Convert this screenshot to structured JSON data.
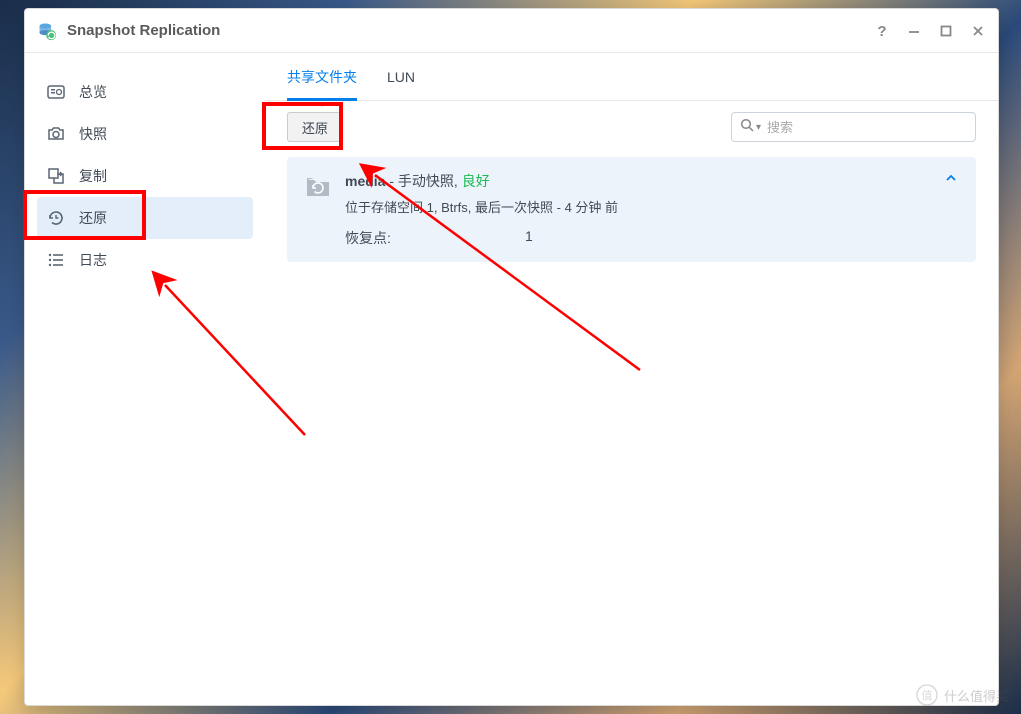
{
  "app": {
    "title": "Snapshot Replication"
  },
  "sidebar": {
    "items": [
      {
        "label": "总览",
        "icon": "overview"
      },
      {
        "label": "快照",
        "icon": "camera"
      },
      {
        "label": "复制",
        "icon": "copy"
      },
      {
        "label": "还原",
        "icon": "restore"
      },
      {
        "label": "日志",
        "icon": "log"
      }
    ]
  },
  "tabs": {
    "items": [
      {
        "label": "共享文件夹"
      },
      {
        "label": "LUN"
      }
    ]
  },
  "toolbar": {
    "restore_label": "还原"
  },
  "search": {
    "placeholder": "搜索"
  },
  "folder": {
    "name": "media",
    "sep": " - ",
    "type": "手动快照,",
    "status": "良好",
    "location": "位于存储空间 1, Btrfs, 最后一次快照 - 4 分钟 前",
    "recovery_label": "恢复点:",
    "recovery_count": "1"
  },
  "watermark": {
    "text": "什么值得买"
  }
}
